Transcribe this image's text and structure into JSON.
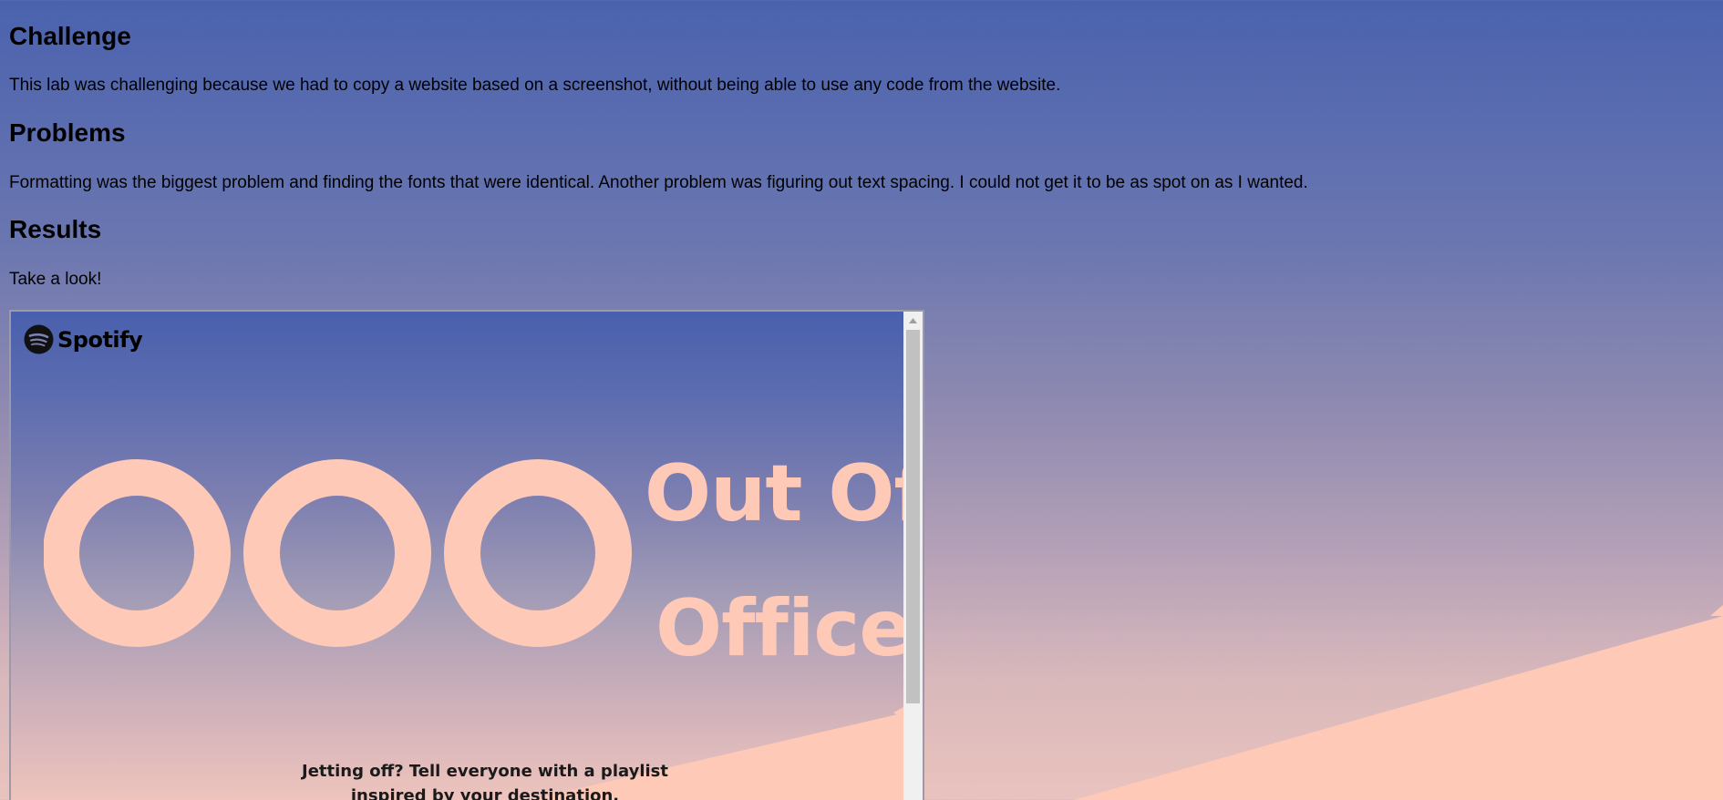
{
  "sections": {
    "challenge": {
      "heading": "Challenge",
      "text": "This lab was challenging because we had to copy a website based on a screenshot, without being able to use any code from the website."
    },
    "problems": {
      "heading": "Problems",
      "text": "Formatting was the biggest problem and finding the fonts that were identical. Another problem was figuring out text spacing. I could not get it to be as spot on as I wanted."
    },
    "results": {
      "heading": "Results",
      "text": "Take a look!"
    }
  },
  "embed": {
    "brand": "Spotify",
    "brand_icon": "spotify-logo-icon",
    "headline_letters": "OOO",
    "tagline_line1": "Out Of",
    "tagline_line2": "Office",
    "subcopy_line1": "Jetting off? Tell everyone with a playlist",
    "subcopy_line2": "inspired by your destination.",
    "colors": {
      "accent_peach": "#ffc9b8",
      "top_blue": "#4960ad"
    }
  }
}
